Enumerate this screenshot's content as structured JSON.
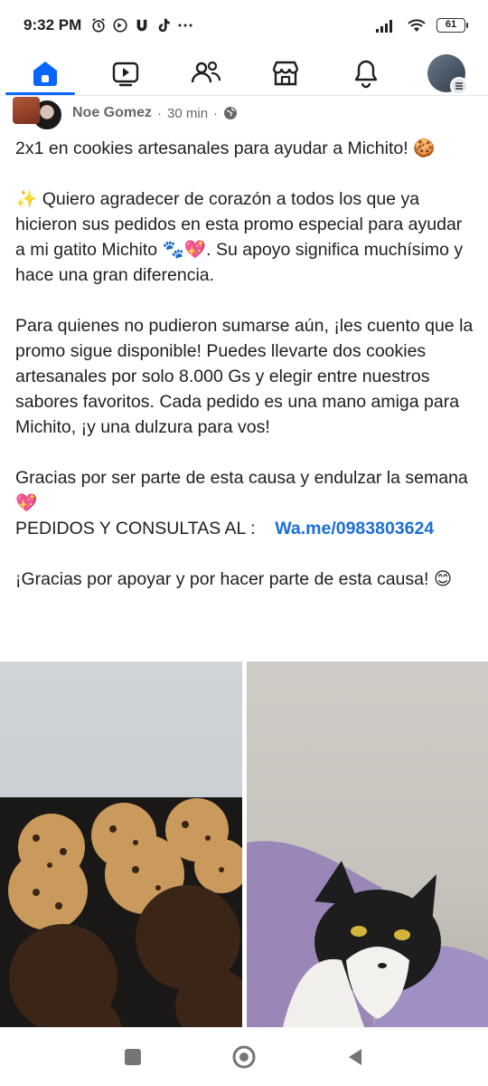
{
  "status_bar": {
    "time": "9:32 PM",
    "battery": "61",
    "icons": [
      "alarm-icon",
      "sync-icon",
      "u-app-icon",
      "tiktok-icon",
      "more-dots-icon",
      "signal-icon",
      "wifi-icon",
      "battery-icon"
    ]
  },
  "nav": {
    "items": [
      "home-icon",
      "video-icon",
      "friends-icon",
      "marketplace-icon",
      "notifications-icon",
      "profile-avatar"
    ],
    "active": "home",
    "accent": "#0866ff"
  },
  "post": {
    "author": "Noe Gomez",
    "separator": "·",
    "time": "30 min",
    "visibility_separator": "·",
    "p1": "2x1 en cookies artesanales para ayudar a Michito! 🍪",
    "p2": "✨ Quiero agradecer de corazón a todos los que ya hicieron sus pedidos en esta promo especial para ayudar a mi gatito Michito 🐾💖. Su apoyo significa muchísimo y hace una gran diferencia.",
    "p3": "Para quienes no pudieron sumarse aún, ¡les cuento que la promo sigue disponible! Puedes llevarte dos cookies artesanales por solo 8.000 Gs y elegir entre nuestros sabores favoritos. Cada pedido es una mano amiga para Michito, ¡y una dulzura para vos!",
    "p4_line1": "Gracias por ser parte de esta causa y endulzar la semana 💖",
    "p4_line2": "PEDIDOS Y CONSULTAS AL :",
    "link": "Wa.me/0983803624",
    "p5": "¡Gracias por apoyar y por hacer parte de esta causa! 😊",
    "link_color": "#1a6ed8"
  },
  "photos": [
    "cookies-photo",
    "cat-photo"
  ]
}
